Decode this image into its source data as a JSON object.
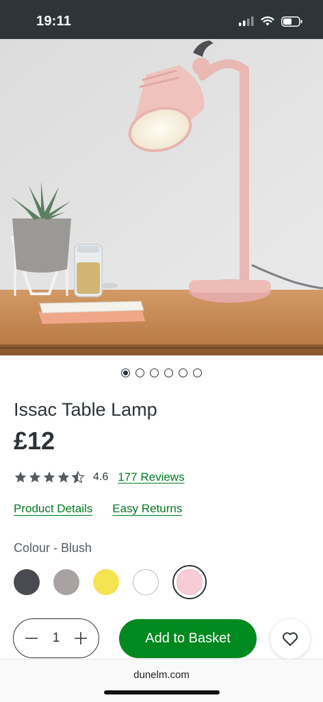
{
  "status_bar": {
    "time": "19:11"
  },
  "product": {
    "title": "Issac Table Lamp",
    "price": "£12",
    "rating": 4.6,
    "rating_label": "4.6",
    "reviews_link": "177 Reviews"
  },
  "gallery": {
    "image_count": 6,
    "active_index": 0
  },
  "links": {
    "product_details": "Product Details",
    "easy_returns": "Easy Returns"
  },
  "colour": {
    "label": "Colour - Blush",
    "options": [
      {
        "name": "charcoal",
        "color": "#4a4b50"
      },
      {
        "name": "grey",
        "color": "#a8a2a2"
      },
      {
        "name": "yellow",
        "color": "#f5e451"
      },
      {
        "name": "white",
        "color": "#ffffff"
      },
      {
        "name": "blush",
        "color": "#f6ccd6",
        "selected": true
      }
    ]
  },
  "purchase": {
    "quantity": "1",
    "add_to_basket": "Add to Basket"
  },
  "browser": {
    "url": "dunelm.com"
  },
  "colors": {
    "accent_green": "#00891e",
    "link_green": "#007a1f",
    "text_dark": "#2b3338"
  }
}
